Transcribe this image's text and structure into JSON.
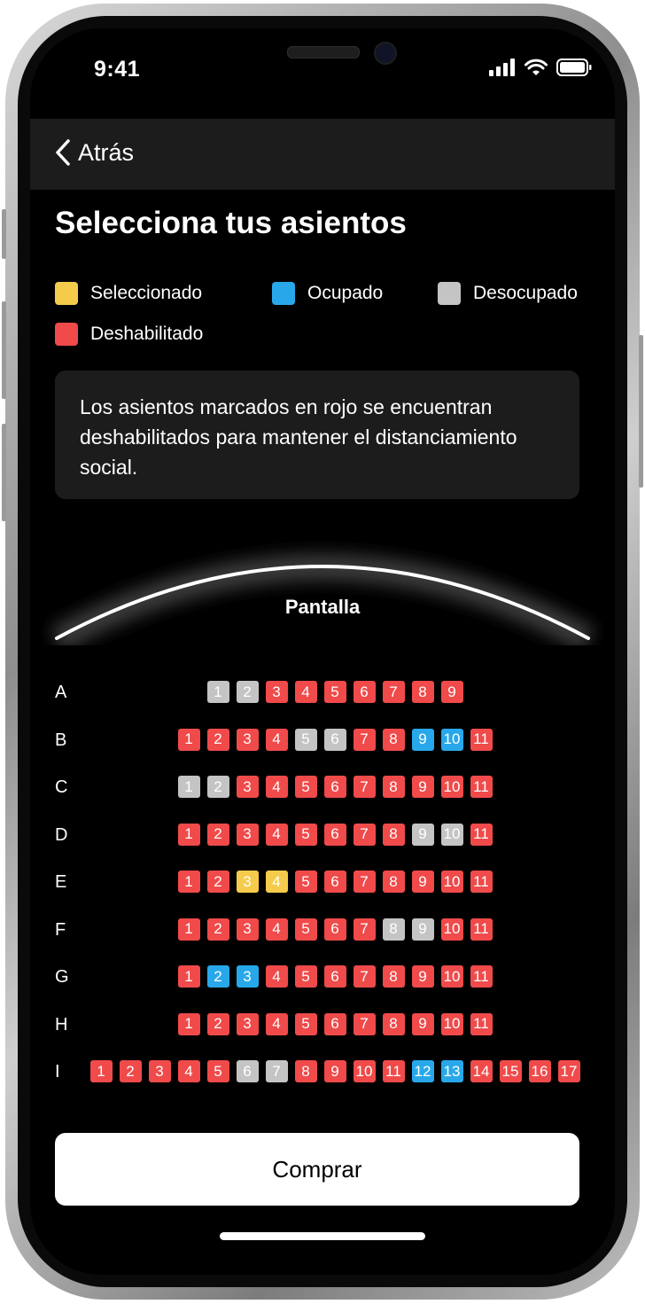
{
  "status": {
    "time": "9:41"
  },
  "nav": {
    "back_label": "Atrás"
  },
  "title": "Selecciona tus asientos",
  "colors": {
    "selected": "#f5cb4b",
    "occupied": "#28a8ea",
    "free": "#c4c4c4",
    "disabled": "#f04a4a"
  },
  "legend": [
    {
      "key": "selected",
      "label": "Seleccionado"
    },
    {
      "key": "occupied",
      "label": "Ocupado"
    },
    {
      "key": "free",
      "label": "Desocupado"
    },
    {
      "key": "disabled",
      "label": "Deshabilitado"
    }
  ],
  "info": "Los asientos marcados en rojo se encuentran deshabilitados para mantener el distanciamiento social.",
  "screen_label": "Pantalla",
  "rows": [
    {
      "label": "A",
      "seats": [
        {
          "n": "1",
          "s": "free"
        },
        {
          "n": "2",
          "s": "free"
        },
        {
          "n": "3",
          "s": "disabled"
        },
        {
          "n": "4",
          "s": "disabled"
        },
        {
          "n": "5",
          "s": "disabled"
        },
        {
          "n": "6",
          "s": "disabled"
        },
        {
          "n": "7",
          "s": "disabled"
        },
        {
          "n": "8",
          "s": "disabled"
        },
        {
          "n": "9",
          "s": "disabled"
        }
      ]
    },
    {
      "label": "B",
      "seats": [
        {
          "n": "1",
          "s": "disabled"
        },
        {
          "n": "2",
          "s": "disabled"
        },
        {
          "n": "3",
          "s": "disabled"
        },
        {
          "n": "4",
          "s": "disabled"
        },
        {
          "n": "5",
          "s": "free"
        },
        {
          "n": "6",
          "s": "free"
        },
        {
          "n": "7",
          "s": "disabled"
        },
        {
          "n": "8",
          "s": "disabled"
        },
        {
          "n": "9",
          "s": "occupied"
        },
        {
          "n": "10",
          "s": "occupied"
        },
        {
          "n": "11",
          "s": "disabled"
        }
      ]
    },
    {
      "label": "C",
      "seats": [
        {
          "n": "1",
          "s": "free"
        },
        {
          "n": "2",
          "s": "free"
        },
        {
          "n": "3",
          "s": "disabled"
        },
        {
          "n": "4",
          "s": "disabled"
        },
        {
          "n": "5",
          "s": "disabled"
        },
        {
          "n": "6",
          "s": "disabled"
        },
        {
          "n": "7",
          "s": "disabled"
        },
        {
          "n": "8",
          "s": "disabled"
        },
        {
          "n": "9",
          "s": "disabled"
        },
        {
          "n": "10",
          "s": "disabled"
        },
        {
          "n": "11",
          "s": "disabled"
        }
      ]
    },
    {
      "label": "D",
      "seats": [
        {
          "n": "1",
          "s": "disabled"
        },
        {
          "n": "2",
          "s": "disabled"
        },
        {
          "n": "3",
          "s": "disabled"
        },
        {
          "n": "4",
          "s": "disabled"
        },
        {
          "n": "5",
          "s": "disabled"
        },
        {
          "n": "6",
          "s": "disabled"
        },
        {
          "n": "7",
          "s": "disabled"
        },
        {
          "n": "8",
          "s": "disabled"
        },
        {
          "n": "9",
          "s": "free"
        },
        {
          "n": "10",
          "s": "free"
        },
        {
          "n": "11",
          "s": "disabled"
        }
      ]
    },
    {
      "label": "E",
      "seats": [
        {
          "n": "1",
          "s": "disabled"
        },
        {
          "n": "2",
          "s": "disabled"
        },
        {
          "n": "3",
          "s": "selected"
        },
        {
          "n": "4",
          "s": "selected"
        },
        {
          "n": "5",
          "s": "disabled"
        },
        {
          "n": "6",
          "s": "disabled"
        },
        {
          "n": "7",
          "s": "disabled"
        },
        {
          "n": "8",
          "s": "disabled"
        },
        {
          "n": "9",
          "s": "disabled"
        },
        {
          "n": "10",
          "s": "disabled"
        },
        {
          "n": "11",
          "s": "disabled"
        }
      ]
    },
    {
      "label": "F",
      "seats": [
        {
          "n": "1",
          "s": "disabled"
        },
        {
          "n": "2",
          "s": "disabled"
        },
        {
          "n": "3",
          "s": "disabled"
        },
        {
          "n": "4",
          "s": "disabled"
        },
        {
          "n": "5",
          "s": "disabled"
        },
        {
          "n": "6",
          "s": "disabled"
        },
        {
          "n": "7",
          "s": "disabled"
        },
        {
          "n": "8",
          "s": "free"
        },
        {
          "n": "9",
          "s": "free"
        },
        {
          "n": "10",
          "s": "disabled"
        },
        {
          "n": "11",
          "s": "disabled"
        }
      ]
    },
    {
      "label": "G",
      "seats": [
        {
          "n": "1",
          "s": "disabled"
        },
        {
          "n": "2",
          "s": "occupied"
        },
        {
          "n": "3",
          "s": "occupied"
        },
        {
          "n": "4",
          "s": "disabled"
        },
        {
          "n": "5",
          "s": "disabled"
        },
        {
          "n": "6",
          "s": "disabled"
        },
        {
          "n": "7",
          "s": "disabled"
        },
        {
          "n": "8",
          "s": "disabled"
        },
        {
          "n": "9",
          "s": "disabled"
        },
        {
          "n": "10",
          "s": "disabled"
        },
        {
          "n": "11",
          "s": "disabled"
        }
      ]
    },
    {
      "label": "H",
      "seats": [
        {
          "n": "1",
          "s": "disabled"
        },
        {
          "n": "2",
          "s": "disabled"
        },
        {
          "n": "3",
          "s": "disabled"
        },
        {
          "n": "4",
          "s": "disabled"
        },
        {
          "n": "5",
          "s": "disabled"
        },
        {
          "n": "6",
          "s": "disabled"
        },
        {
          "n": "7",
          "s": "disabled"
        },
        {
          "n": "8",
          "s": "disabled"
        },
        {
          "n": "9",
          "s": "disabled"
        },
        {
          "n": "10",
          "s": "disabled"
        },
        {
          "n": "11",
          "s": "disabled"
        }
      ]
    },
    {
      "label": "I",
      "seats": [
        {
          "n": "1",
          "s": "disabled"
        },
        {
          "n": "2",
          "s": "disabled"
        },
        {
          "n": "3",
          "s": "disabled"
        },
        {
          "n": "4",
          "s": "disabled"
        },
        {
          "n": "5",
          "s": "disabled"
        },
        {
          "n": "6",
          "s": "free"
        },
        {
          "n": "7",
          "s": "free"
        },
        {
          "n": "8",
          "s": "disabled"
        },
        {
          "n": "9",
          "s": "disabled"
        },
        {
          "n": "10",
          "s": "disabled"
        },
        {
          "n": "11",
          "s": "disabled"
        },
        {
          "n": "12",
          "s": "occupied"
        },
        {
          "n": "13",
          "s": "occupied"
        },
        {
          "n": "14",
          "s": "disabled"
        },
        {
          "n": "15",
          "s": "disabled"
        },
        {
          "n": "16",
          "s": "disabled"
        },
        {
          "n": "17",
          "s": "disabled"
        }
      ]
    }
  ],
  "buy_label": "Comprar"
}
